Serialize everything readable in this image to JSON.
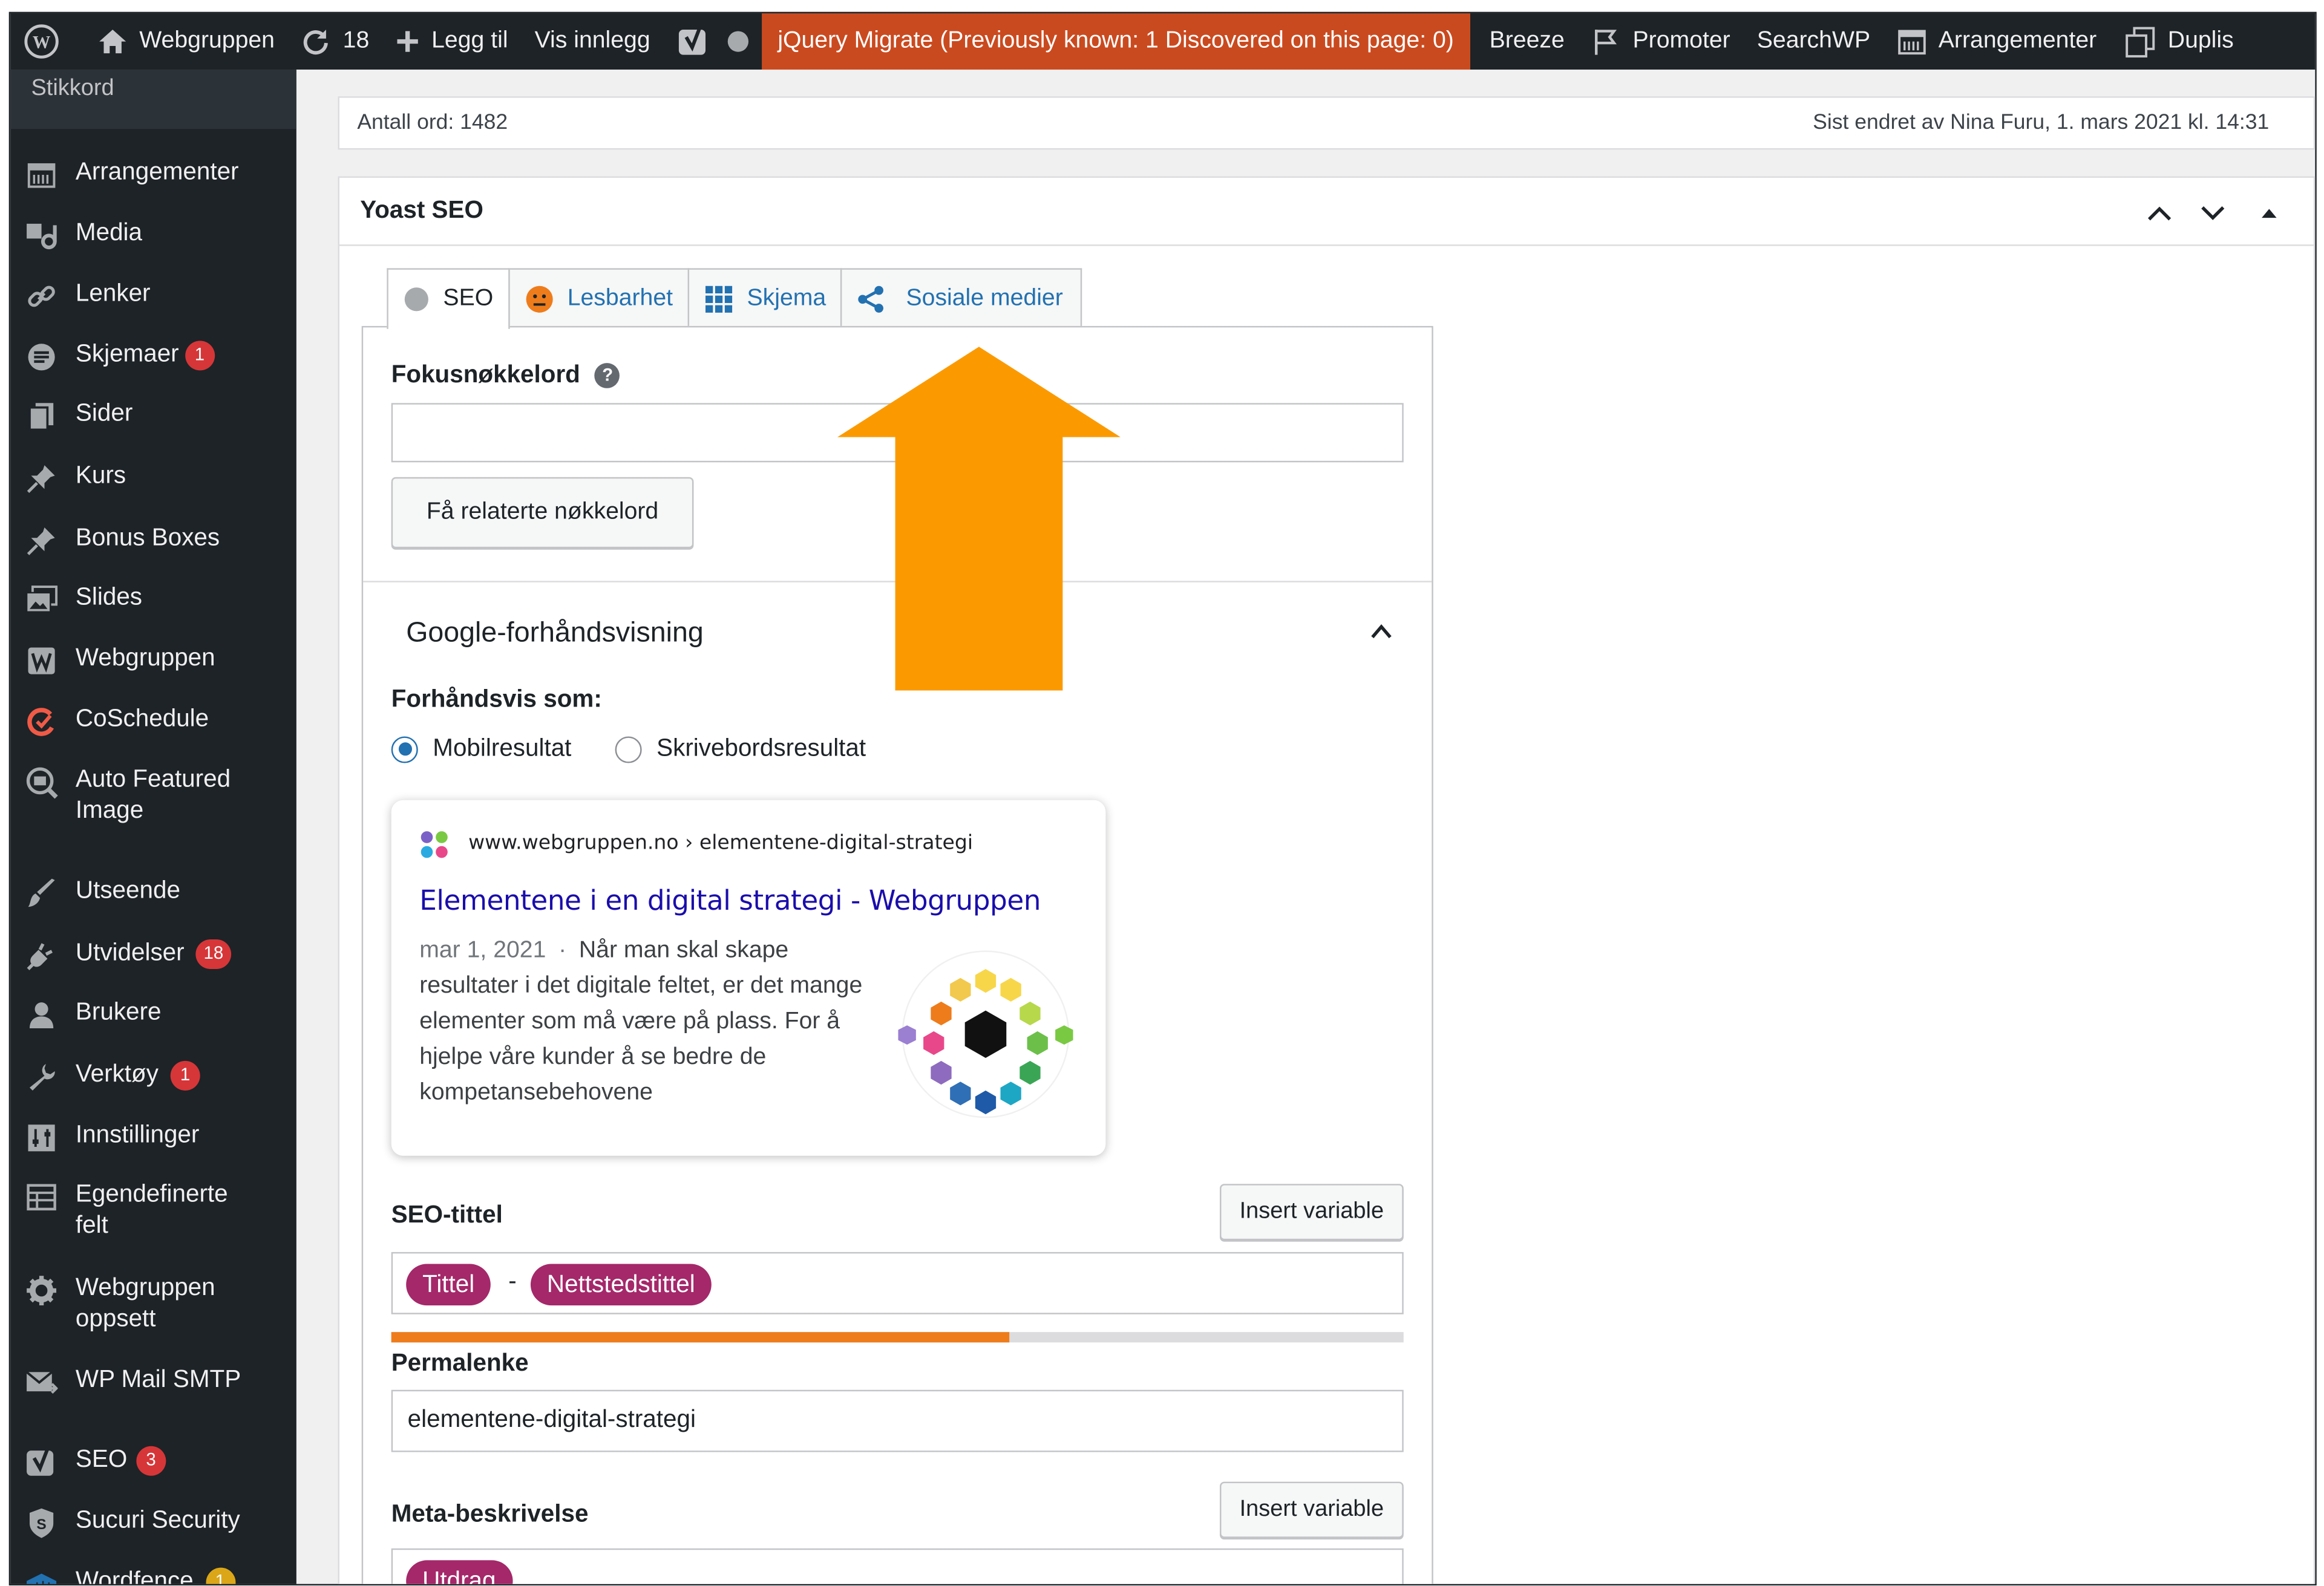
{
  "admin_bar": {
    "site_name": "Webgruppen",
    "updates_count": "18",
    "add_new": "Legg til",
    "view_post": "Vis innlegg",
    "jquery_migrate": "jQuery Migrate (Previously known: 1 Discovered on this page: 0)",
    "breeze": "Breeze",
    "promoter": "Promoter",
    "searchwp": "SearchWP",
    "events": "Arrangementer",
    "duplicate": "Duplis"
  },
  "sidebar": {
    "submenu_label": "Stikkord",
    "items": [
      {
        "label": "Arrangementer",
        "icon": "calendar-icon"
      },
      {
        "label": "Media",
        "icon": "media-icon"
      },
      {
        "label": "Lenker",
        "icon": "link-icon"
      },
      {
        "label": "Skjemaer",
        "icon": "forms-icon",
        "badge": "1"
      },
      {
        "label": "Sider",
        "icon": "pages-icon"
      },
      {
        "label": "Kurs",
        "icon": "pin-icon"
      },
      {
        "label": "Bonus Boxes",
        "icon": "pin-icon"
      },
      {
        "label": "Slides",
        "icon": "slides-icon"
      },
      {
        "label": "Webgruppen",
        "icon": "w-icon"
      },
      {
        "label": "CoSchedule",
        "icon": "coschedule-icon"
      },
      {
        "label": "Auto Featured",
        "label2": "Image",
        "icon": "image-search-icon"
      },
      {
        "label": "Utseende",
        "icon": "brush-icon"
      },
      {
        "label": "Utvidelser",
        "icon": "plugin-icon",
        "badge": "18"
      },
      {
        "label": "Brukere",
        "icon": "user-icon"
      },
      {
        "label": "Verktøy",
        "icon": "wrench-icon",
        "badge": "1"
      },
      {
        "label": "Innstillinger",
        "icon": "settings-icon"
      },
      {
        "label": "Egendefinerte",
        "label2": "felt",
        "icon": "table-icon"
      },
      {
        "label": "Webgruppen",
        "label2": "oppsett",
        "icon": "gear-icon"
      },
      {
        "label": "WP Mail SMTP",
        "icon": "mail-icon"
      },
      {
        "label": "SEO",
        "icon": "yoast-icon",
        "badge": "3"
      },
      {
        "label": "Sucuri Security",
        "icon": "shield-icon"
      },
      {
        "label": "Wordfence",
        "icon": "wordfence-icon",
        "badge": "1"
      }
    ]
  },
  "word_count": {
    "left": "Antall ord: 1482",
    "right": "Sist endret av Nina Furu, 1. mars 2021 kl. 14:31"
  },
  "yoast": {
    "title": "Yoast SEO",
    "tabs": [
      "SEO",
      "Lesbarhet",
      "Skjema",
      "Sosiale medier"
    ],
    "focus_keyword_label": "Fokusnøkkelord",
    "focus_keyword_value": "",
    "related_keywords_button": "Få relaterte nøkkelord",
    "google_preview_title": "Google-forhåndsvisning",
    "preview_as_label": "Forhåndsvis som:",
    "radio_mobile": "Mobilresultat",
    "radio_desktop": "Skrivebordsresultat",
    "preview_mode": "mobile",
    "snippet": {
      "url": "www.webgruppen.no › elementene-digital-strategi",
      "title": "Elementene i en digital strategi - Webgruppen",
      "date": "mar 1, 2021",
      "separator": "·",
      "description": "Når man skal skape resultater i det digitale feltet, er det mange elementer som må være på plass. For å hjelpe våre kunder å se bedre de kompetansebehovene"
    },
    "seo_title_label": "SEO-tittel",
    "insert_variable": "Insert variable",
    "seo_title_pills": [
      "Tittel",
      "-",
      "Nettstedstittel"
    ],
    "seo_title_progress": 0.61,
    "permalink_label": "Permalenke",
    "permalink_value": "elementene-digital-strategi",
    "meta_desc_label": "Meta-beskrivelse",
    "meta_desc_pill": "Utdrag"
  },
  "colors": {
    "admin_dark": "#1d2327",
    "warning_orange": "#ca4a1f",
    "wp_blue": "#2271b1",
    "yoast_pill": "#a4286a",
    "progress_orange": "#ee7c1b",
    "arrow_orange": "#fb9a00",
    "badge_red": "#d63638"
  }
}
